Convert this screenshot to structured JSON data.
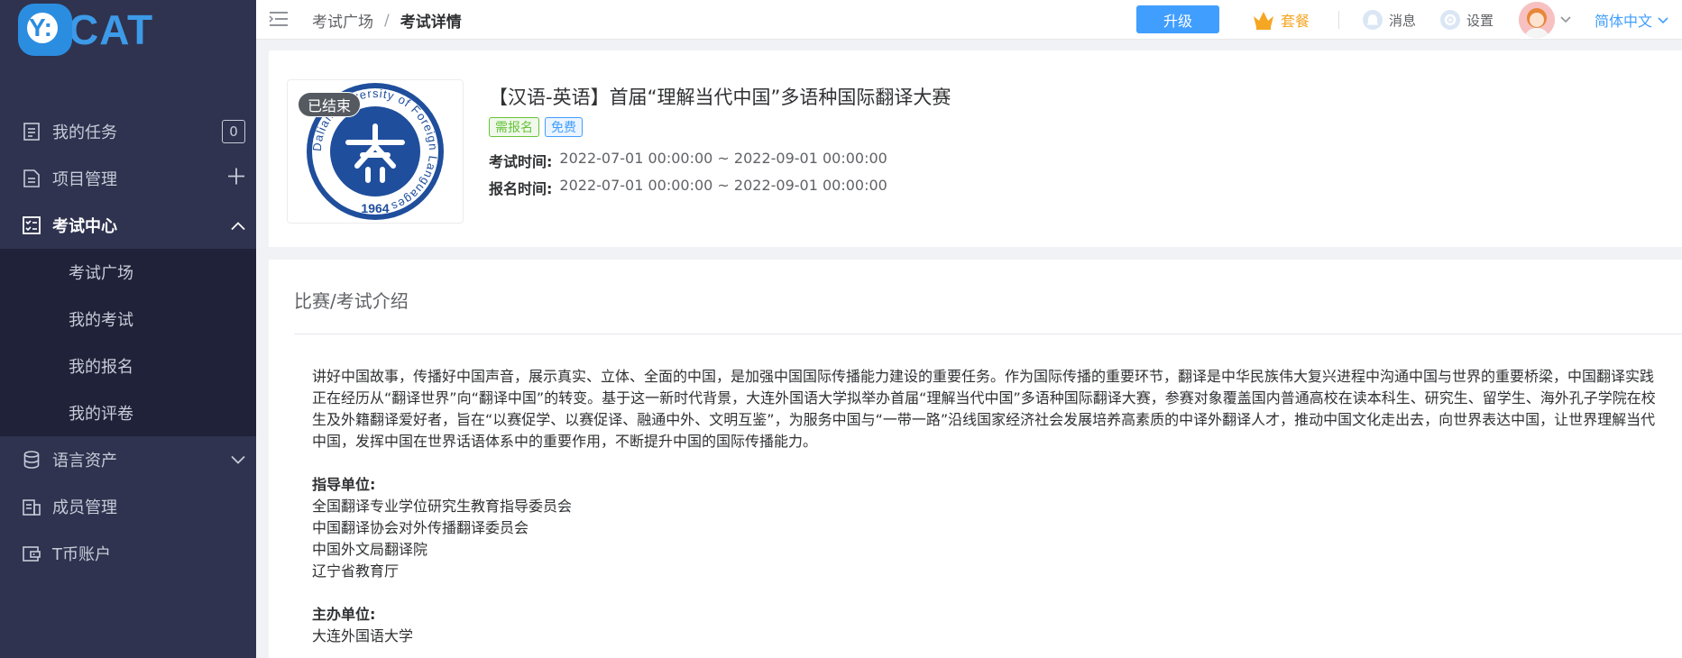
{
  "brand": {
    "logo_letter": "Y:",
    "logo_text": "CAT"
  },
  "sidebar": {
    "items": [
      {
        "label": "我的任务",
        "icon": "task-icon",
        "badge": "0"
      },
      {
        "label": "项目管理",
        "icon": "project-icon",
        "right": "plus-icon"
      },
      {
        "label": "考试中心",
        "icon": "exam-icon",
        "right": "chevron-up-icon",
        "active": true
      },
      {
        "label": "语言资产",
        "icon": "database-icon",
        "right": "chevron-down-icon"
      },
      {
        "label": "成员管理",
        "icon": "members-icon"
      },
      {
        "label": "T币账户",
        "icon": "wallet-icon"
      }
    ],
    "submenu": [
      "考试广场",
      "我的考试",
      "我的报名",
      "我的评卷"
    ]
  },
  "header": {
    "breadcrumb": [
      "考试广场",
      "考试详情"
    ],
    "breadcrumb_sep": "/",
    "upgrade_label": "升级",
    "package_label": "套餐",
    "messages_label": "消息",
    "settings_label": "设置",
    "language_label": "简体中文"
  },
  "exam": {
    "status": "已结束",
    "title": "【汉语-英语】首届“理解当代中国”多语种国际翻译大赛",
    "tags": [
      "需报名",
      "免费"
    ],
    "exam_time_label": "考试时间:",
    "exam_time": "2022-07-01 00:00:00 ~ 2022-09-01 00:00:00",
    "signup_time_label": "报名时间:",
    "signup_time": "2022-07-01 00:00:00 ~ 2022-09-01 00:00:00",
    "logo_year": "1964",
    "logo_ring_text": "Dalian University of Foreign Languages"
  },
  "intro": {
    "title": "比赛/考试介绍",
    "paragraph": "讲好中国故事，传播好中国声音，展示真实、立体、全面的中国，是加强中国国际传播能力建设的重要任务。作为国际传播的重要环节，翻译是中华民族伟大复兴进程中沟通中国与世界的重要桥梁，中国翻译实践正在经历从“翻译世界”向“翻译中国”的转变。基于这一新时代背景，大连外国语大学拟举办首届“理解当代中国”多语种国际翻译大赛，参赛对象覆盖国内普通高校在读本科生、研究生、留学生、海外孔子学院在校生及外籍翻译爱好者，旨在“以赛促学、以赛促译、融通中外、文明互鉴”，为服务中国与“一带一路”沿线国家经济社会发展培养高素质的中译外翻译人才，推动中国文化走出去，向世界表达中国，让世界理解当代中国，发挥中国在世界话语体系中的重要作用，不断提升中国的国际传播能力。",
    "guide_label": "指导单位:",
    "guide_units": [
      "全国翻译专业学位研究生教育指导委员会",
      "中国翻译协会对外传播翻译委员会",
      "中国外文局翻译院",
      "辽宁省教育厅"
    ],
    "host_label": "主办单位:",
    "host_units": [
      "大连外国语大学"
    ]
  },
  "colors": {
    "sidebar_bg": "#2f334f",
    "submenu_bg": "#1f2238",
    "accent": "#409eff",
    "package": "#f5a623",
    "tag_green": "#67c23a"
  }
}
